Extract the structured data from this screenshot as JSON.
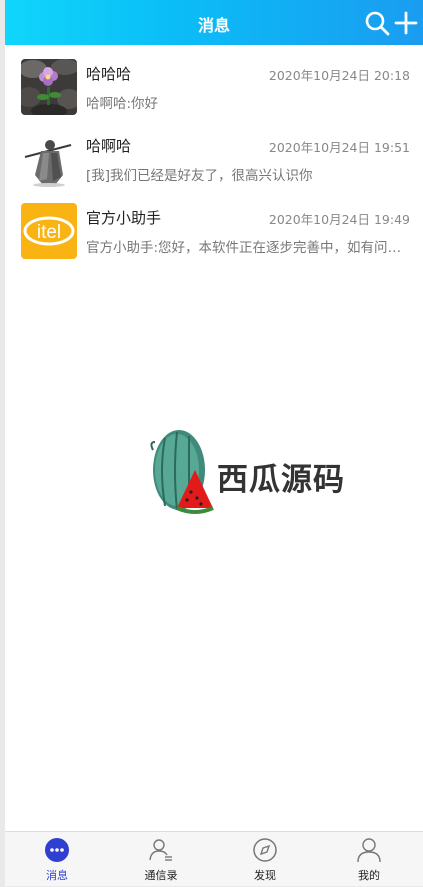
{
  "header": {
    "title": "消息",
    "search_icon": "search-icon",
    "add_icon": "plus-icon",
    "gradient_start": "#10d6fb",
    "gradient_end": "#1a9cf0"
  },
  "conversations": [
    {
      "name": "哈哈哈",
      "time": "2020年10月24日 20:18",
      "preview": "哈啊哈:你好",
      "avatar": "flower-photo"
    },
    {
      "name": "哈啊哈",
      "time": "2020年10月24日 19:51",
      "preview": "[我]我们已经是好友了，很高兴认识你",
      "avatar": "warrior-figure"
    },
    {
      "name": "官方小助手",
      "time": "2020年10月24日 19:49",
      "preview": "官方小助手:您好，本软件正在逐步完善中，如有问题请反馈",
      "avatar": "itel-logo"
    }
  ],
  "watermark": {
    "text": "西瓜源码",
    "icon": "watermelon-logo"
  },
  "tabbar": {
    "active_color": "#2f3fd0",
    "tabs": [
      {
        "label": "消息",
        "icon": "chat-bubble-icon",
        "active": true
      },
      {
        "label": "通信录",
        "icon": "contacts-icon",
        "active": false
      },
      {
        "label": "发现",
        "icon": "compass-icon",
        "active": false
      },
      {
        "label": "我的",
        "icon": "person-icon",
        "active": false
      }
    ]
  }
}
